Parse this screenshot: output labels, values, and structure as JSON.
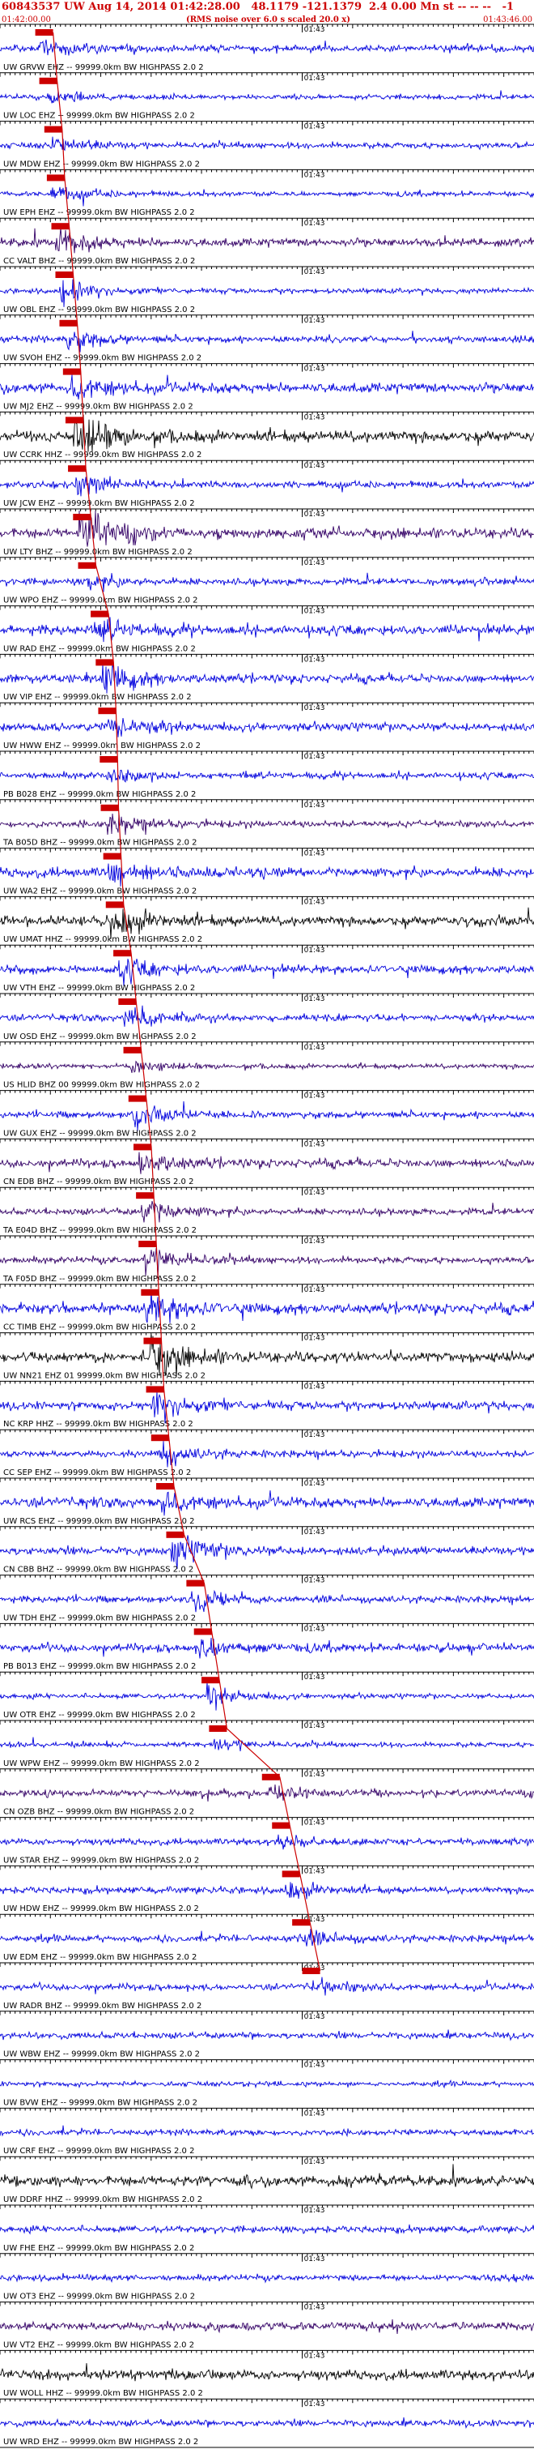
{
  "header": {
    "title": "60843537 UW Aug 14, 2014 01:42:28.00   48.1179 -121.1379  2.4 0.00 Mn st -- -- --   -1",
    "start_time": "01:42:00.00",
    "end_time": "01:43:46.00",
    "scale_note": "(RMS noise over 6.0 s scaled 20.0 x)"
  },
  "chart_data": {
    "type": "seismogram",
    "title": "60843537 UW Aug 14, 2014 01:42:28.00   48.1179 -121.1379  2.4 0.00 Mn st -- -- --   -1",
    "time_start": "01:42:00.00",
    "time_end": "01:43:46.00",
    "minute_marker": "01:43",
    "colors": {
      "blue": "#0000dd",
      "black": "#000000",
      "purple": "#330066",
      "pick": "#cc0000"
    },
    "channels": [
      {
        "label": "UW GRVW EHZ -- 99999.0km BW  HIGHPASS  2.0  2",
        "color": "blue",
        "pick_s": 7.0,
        "amp": 0.2,
        "event_s": 8.0,
        "event_amp": 0.5
      },
      {
        "label": "UW LOC EHZ -- 99999.0km BW  HIGHPASS  2.0  2",
        "color": "blue",
        "pick_s": 7.8,
        "amp": 0.15,
        "event_s": 9.0,
        "event_amp": 0.4
      },
      {
        "label": "UW MDW EHZ -- 99999.0km BW  HIGHPASS  2.0  2",
        "color": "blue",
        "pick_s": 8.8,
        "amp": 0.18,
        "event_s": 10.0,
        "event_amp": 0.5
      },
      {
        "label": "UW EPH EHZ -- 99999.0km BW  HIGHPASS  2.0  2",
        "color": "blue",
        "pick_s": 9.3,
        "amp": 0.15,
        "event_s": 10.0,
        "event_amp": 0.4
      },
      {
        "label": "CC VALT BHZ -- 99999.0km BW  HIGHPASS  2.0  2",
        "color": "purple",
        "pick_s": 10.2,
        "amp": 0.25,
        "event_s": 11.0,
        "event_amp": 0.6
      },
      {
        "label": "UW OBL EHZ -- 99999.0km BW  HIGHPASS  2.0  2",
        "color": "blue",
        "pick_s": 11.0,
        "amp": 0.15,
        "event_s": 12.0,
        "event_amp": 0.5
      },
      {
        "label": "UW SVOH EHZ -- 99999.0km BW  HIGHPASS  2.0  2",
        "color": "blue",
        "pick_s": 11.8,
        "amp": 0.2,
        "event_s": 13.0,
        "event_amp": 0.5
      },
      {
        "label": "UW MJ2 EHZ -- 99999.0km BW  HIGHPASS  2.0  2",
        "color": "blue",
        "pick_s": 12.5,
        "amp": 0.3,
        "event_s": 14.0,
        "event_amp": 0.7
      },
      {
        "label": "UW CCRK HHZ -- 99999.0km BW  HIGHPASS  2.0  2",
        "color": "black",
        "pick_s": 13.0,
        "amp": 0.35,
        "event_s": 14.5,
        "event_amp": 1.2
      },
      {
        "label": "UW JCW EHZ -- 99999.0km BW  HIGHPASS  2.0  2",
        "color": "blue",
        "pick_s": 13.5,
        "amp": 0.2,
        "event_s": 15.0,
        "event_amp": 0.6
      },
      {
        "label": "UW LTY BHZ -- 99999.0km BW  HIGHPASS  2.0  2",
        "color": "purple",
        "pick_s": 14.5,
        "amp": 0.3,
        "event_s": 15.5,
        "event_amp": 1.2
      },
      {
        "label": "UW WPO EHZ -- 99999.0km BW  HIGHPASS  2.0  2",
        "color": "blue",
        "pick_s": 15.5,
        "amp": 0.2,
        "event_s": 17.0,
        "event_amp": 0.4
      },
      {
        "label": "UW RAD EHZ -- 99999.0km BW  HIGHPASS  2.0  2",
        "color": "blue",
        "pick_s": 18.0,
        "amp": 0.3,
        "event_s": 19.0,
        "event_amp": 0.5
      },
      {
        "label": "UW VIP EHZ -- 99999.0km BW  HIGHPASS  2.0  2",
        "color": "blue",
        "pick_s": 19.0,
        "amp": 0.25,
        "event_s": 20.0,
        "event_amp": 0.8
      },
      {
        "label": "UW HWW EHZ -- 99999.0km BW  HIGHPASS  2.0  2",
        "color": "blue",
        "pick_s": 19.5,
        "amp": 0.25,
        "event_s": 20.5,
        "event_amp": 0.6
      },
      {
        "label": "PB B028 EHZ -- 99999.0km BW  HIGHPASS  2.0  2",
        "color": "blue",
        "pick_s": 19.8,
        "amp": 0.2,
        "event_s": 21.0,
        "event_amp": 0.5
      },
      {
        "label": "TA B05D BHZ -- 99999.0km BW  HIGHPASS  2.0  2",
        "color": "purple",
        "pick_s": 20.0,
        "amp": 0.2,
        "event_s": 21.0,
        "event_amp": 0.5
      },
      {
        "label": "UW WA2 EHZ -- 99999.0km BW  HIGHPASS  2.0  2",
        "color": "blue",
        "pick_s": 20.5,
        "amp": 0.3,
        "event_s": 21.5,
        "event_amp": 0.6
      },
      {
        "label": "UW UMAT HHZ -- 99999.0km BW  HIGHPASS  2.0  2",
        "color": "black",
        "pick_s": 21.0,
        "amp": 0.3,
        "event_s": 22.0,
        "event_amp": 0.8
      },
      {
        "label": "UW VTH EHZ -- 99999.0km BW  HIGHPASS  2.0  2",
        "color": "blue",
        "pick_s": 22.5,
        "amp": 0.25,
        "event_s": 23.5,
        "event_amp": 0.6
      },
      {
        "label": "UW OSD EHZ -- 99999.0km BW  HIGHPASS  2.0  2",
        "color": "blue",
        "pick_s": 23.5,
        "amp": 0.2,
        "event_s": 24.5,
        "event_amp": 0.6
      },
      {
        "label": "US HLID BHZ 00 99999.0km BW  HIGHPASS  2.0  2",
        "color": "purple",
        "pick_s": 24.5,
        "amp": 0.15,
        "event_s": 25.5,
        "event_amp": 0.3
      },
      {
        "label": "UW GUX EHZ -- 99999.0km BW  HIGHPASS  2.0  2",
        "color": "blue",
        "pick_s": 25.5,
        "amp": 0.2,
        "event_s": 26.5,
        "event_amp": 0.5
      },
      {
        "label": "CN EDB BHZ -- 99999.0km BW  HIGHPASS  2.0  2",
        "color": "purple",
        "pick_s": 26.5,
        "amp": 0.25,
        "event_s": 27.5,
        "event_amp": 0.6
      },
      {
        "label": "TA E04D BHZ -- 99999.0km BW  HIGHPASS  2.0  2",
        "color": "purple",
        "pick_s": 27.0,
        "amp": 0.2,
        "event_s": 28.0,
        "event_amp": 0.8
      },
      {
        "label": "TA F05D BHZ -- 99999.0km BW  HIGHPASS  2.0  2",
        "color": "purple",
        "pick_s": 27.5,
        "amp": 0.2,
        "event_s": 28.5,
        "event_amp": 0.8
      },
      {
        "label": "CC TIMB EHZ -- 99999.0km BW  HIGHPASS  2.0  2",
        "color": "blue",
        "pick_s": 28.0,
        "amp": 0.3,
        "event_s": 29.0,
        "event_amp": 1.0
      },
      {
        "label": "UW NN21 EHZ 01 99999.0km BW  HIGHPASS  2.0  2",
        "color": "black",
        "pick_s": 28.5,
        "amp": 0.3,
        "event_s": 29.5,
        "event_amp": 1.2
      },
      {
        "label": "NC KRP HHZ -- 99999.0km BW  HIGHPASS  2.0  2",
        "color": "blue",
        "pick_s": 29.0,
        "amp": 0.25,
        "event_s": 30.0,
        "event_amp": 0.7
      },
      {
        "label": "CC SEP EHZ -- 99999.0km BW  HIGHPASS  2.0  2",
        "color": "blue",
        "pick_s": 30.0,
        "amp": 0.2,
        "event_s": 31.0,
        "event_amp": 0.6
      },
      {
        "label": "UW RCS EHZ -- 99999.0km BW  HIGHPASS  2.0  2",
        "color": "blue",
        "pick_s": 31.0,
        "amp": 0.3,
        "event_s": 32.0,
        "event_amp": 0.6
      },
      {
        "label": "CN CBB BHZ -- 99999.0km BW  HIGHPASS  2.0  2",
        "color": "blue",
        "pick_s": 33.0,
        "amp": 0.25,
        "event_s": 34.0,
        "event_amp": 0.8
      },
      {
        "label": "UW TDH EHZ -- 99999.0km BW  HIGHPASS  2.0  2",
        "color": "blue",
        "pick_s": 37.0,
        "amp": 0.2,
        "event_s": 38.0,
        "event_amp": 0.5
      },
      {
        "label": "PB B013 EHZ -- 99999.0km BW  HIGHPASS  2.0  2",
        "color": "blue",
        "pick_s": 38.5,
        "amp": 0.25,
        "event_s": 39.5,
        "event_amp": 0.6
      },
      {
        "label": "UW OTR EHZ -- 99999.0km BW  HIGHPASS  2.0  2",
        "color": "blue",
        "pick_s": 40.0,
        "amp": 0.15,
        "event_s": 41.0,
        "event_amp": 0.5
      },
      {
        "label": "UW WPW EHZ -- 99999.0km BW  HIGHPASS  2.0  2",
        "color": "blue",
        "pick_s": 41.5,
        "amp": 0.15,
        "event_s": 42.5,
        "event_amp": 0.3
      },
      {
        "label": "CN OZB BHZ -- 99999.0km BW  HIGHPASS  2.0  2",
        "color": "purple",
        "pick_s": 52.0,
        "amp": 0.2,
        "event_s": 53.0,
        "event_amp": 0.4
      },
      {
        "label": "UW STAR EHZ -- 99999.0km BW  HIGHPASS  2.0  2",
        "color": "blue",
        "pick_s": 54.0,
        "amp": 0.2,
        "event_s": 55.0,
        "event_amp": 0.4
      },
      {
        "label": "UW HDW EHZ -- 99999.0km BW  HIGHPASS  2.0  2",
        "color": "blue",
        "pick_s": 56.0,
        "amp": 0.2,
        "event_s": 57.0,
        "event_amp": 0.4
      },
      {
        "label": "UW EDM EHZ -- 99999.0km BW  HIGHPASS  2.0  2",
        "color": "blue",
        "pick_s": 58.0,
        "amp": 0.2,
        "event_s": 59.0,
        "event_amp": 0.4
      },
      {
        "label": "UW RADR BHZ -- 99999.0km BW  HIGHPASS  2.0  2",
        "color": "blue",
        "pick_s": 60.0,
        "amp": 0.2,
        "event_s": 61.0,
        "event_amp": 0.4
      },
      {
        "label": "UW WBW EHZ -- 99999.0km BW  HIGHPASS  2.0  2",
        "color": "blue",
        "pick_s": null,
        "amp": 0.2
      },
      {
        "label": "UW BVW EHZ -- 99999.0km BW  HIGHPASS  2.0  2",
        "color": "blue",
        "pick_s": null,
        "amp": 0.15
      },
      {
        "label": "UW CRF EHZ -- 99999.0km BW  HIGHPASS  2.0  2",
        "color": "blue",
        "pick_s": null,
        "amp": 0.18
      },
      {
        "label": "UW DDRF HHZ -- 99999.0km BW  HIGHPASS  2.0  2",
        "color": "black",
        "pick_s": null,
        "amp": 0.3
      },
      {
        "label": "UW FHE EHZ -- 99999.0km BW  HIGHPASS  2.0  2",
        "color": "blue",
        "pick_s": null,
        "amp": 0.2
      },
      {
        "label": "UW OT3 EHZ -- 99999.0km BW  HIGHPASS  2.0  2",
        "color": "blue",
        "pick_s": null,
        "amp": 0.18
      },
      {
        "label": "UW VT2 EHZ -- 99999.0km BW  HIGHPASS  2.0  2",
        "color": "purple",
        "pick_s": null,
        "amp": 0.25
      },
      {
        "label": "UW WOLL HHZ -- 99999.0km BW  HIGHPASS  2.0  2",
        "color": "black",
        "pick_s": null,
        "amp": 0.3
      },
      {
        "label": "UW WRD EHZ -- 99999.0km BW  HIGHPASS  2.0  2",
        "color": "blue",
        "pick_s": null,
        "amp": 0.2
      }
    ]
  }
}
